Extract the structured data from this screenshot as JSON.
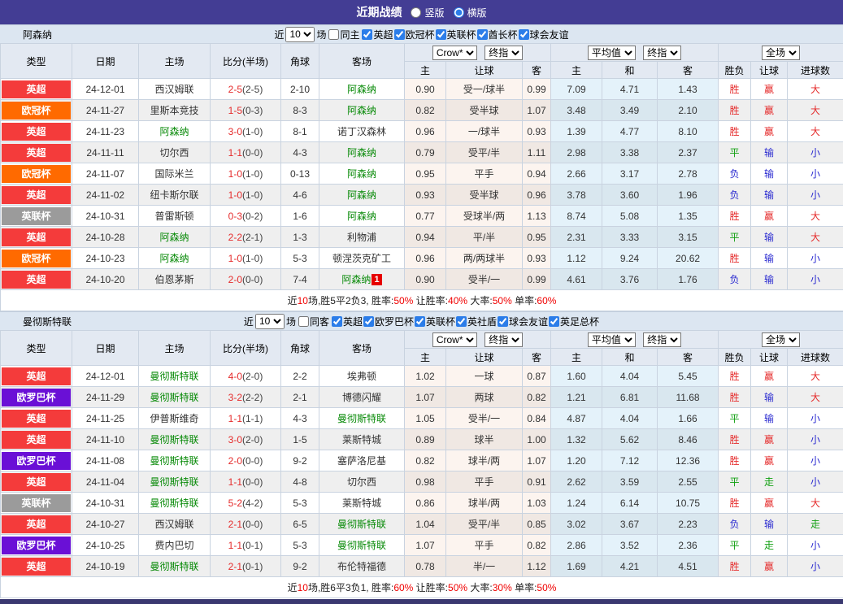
{
  "titlebar": {
    "title": "近期战绩",
    "vertical": "竖版",
    "horizontal": "横版"
  },
  "columns": {
    "type": "类型",
    "date": "日期",
    "home": "主场",
    "score": "比分(半场)",
    "corner": "角球",
    "away": "客场",
    "let_home": "主",
    "let_line": "让球",
    "let_away": "客",
    "avg_home": "主",
    "avg_draw": "和",
    "avg_away": "客",
    "result": "胜负",
    "handicap": "让球",
    "goals": "进球数"
  },
  "selects": {
    "company": "Crow*",
    "final": "终指",
    "average": "平均值",
    "scope": "全场"
  },
  "league_colors": {
    "英超": "#f43b3b",
    "欧冠杯": "#ff6a00",
    "英联杯": "#9b9b9b",
    "欧罗巴杯": "#6a10d6"
  },
  "mark_colors": {
    "胜": "#e52b2b",
    "平": "#12a012",
    "负": "#2a2ad0",
    "赢": "#e52b2b",
    "输": "#2a2ad0",
    "走": "#12a012",
    "大": "#e52b2b",
    "小": "#2a2ad0"
  },
  "sections": [
    {
      "team": "阿森纳",
      "filter": {
        "near_label": "近",
        "count": "10",
        "games_label": "场",
        "same_label": "同主",
        "same_checked": false,
        "leagues": [
          {
            "label": "英超",
            "checked": true
          },
          {
            "label": "欧冠杯",
            "checked": true
          },
          {
            "label": "英联杯",
            "checked": true
          },
          {
            "label": "酋长杯",
            "checked": true
          },
          {
            "label": "球会友谊",
            "checked": true
          }
        ]
      },
      "rows": [
        {
          "league": "英超",
          "date": "24-12-01",
          "home": "西汉姆联",
          "home_focus": false,
          "score": "2-5",
          "half": "(2-5)",
          "corner": "2-10",
          "away": "阿森纳",
          "away_focus": true,
          "let_home": "0.90",
          "let_line": "受一/球半",
          "let_away": "0.99",
          "avg_home": "7.09",
          "avg_draw": "4.71",
          "avg_away": "1.43",
          "result": "胜",
          "handicap": "赢",
          "goals": "大"
        },
        {
          "league": "欧冠杯",
          "date": "24-11-27",
          "home": "里斯本竞技",
          "home_focus": false,
          "score": "1-5",
          "half": "(0-3)",
          "corner": "8-3",
          "away": "阿森纳",
          "away_focus": true,
          "let_home": "0.82",
          "let_line": "受半球",
          "let_away": "1.07",
          "avg_home": "3.48",
          "avg_draw": "3.49",
          "avg_away": "2.10",
          "result": "胜",
          "handicap": "赢",
          "goals": "大"
        },
        {
          "league": "英超",
          "date": "24-11-23",
          "home": "阿森纳",
          "home_focus": true,
          "score": "3-0",
          "half": "(1-0)",
          "corner": "8-1",
          "away": "诺丁汉森林",
          "away_focus": false,
          "let_home": "0.96",
          "let_line": "一/球半",
          "let_away": "0.93",
          "avg_home": "1.39",
          "avg_draw": "4.77",
          "avg_away": "8.10",
          "result": "胜",
          "handicap": "赢",
          "goals": "大"
        },
        {
          "league": "英超",
          "date": "24-11-11",
          "home": "切尔西",
          "home_focus": false,
          "score": "1-1",
          "half": "(0-0)",
          "corner": "4-3",
          "away": "阿森纳",
          "away_focus": true,
          "let_home": "0.79",
          "let_line": "受平/半",
          "let_away": "1.11",
          "avg_home": "2.98",
          "avg_draw": "3.38",
          "avg_away": "2.37",
          "result": "平",
          "handicap": "输",
          "goals": "小"
        },
        {
          "league": "欧冠杯",
          "date": "24-11-07",
          "home": "国际米兰",
          "home_focus": false,
          "score": "1-0",
          "half": "(1-0)",
          "corner": "0-13",
          "away": "阿森纳",
          "away_focus": true,
          "let_home": "0.95",
          "let_line": "平手",
          "let_away": "0.94",
          "avg_home": "2.66",
          "avg_draw": "3.17",
          "avg_away": "2.78",
          "result": "负",
          "handicap": "输",
          "goals": "小"
        },
        {
          "league": "英超",
          "date": "24-11-02",
          "home": "纽卡斯尔联",
          "home_focus": false,
          "score": "1-0",
          "half": "(1-0)",
          "corner": "4-6",
          "away": "阿森纳",
          "away_focus": true,
          "let_home": "0.93",
          "let_line": "受半球",
          "let_away": "0.96",
          "avg_home": "3.78",
          "avg_draw": "3.60",
          "avg_away": "1.96",
          "result": "负",
          "handicap": "输",
          "goals": "小"
        },
        {
          "league": "英联杯",
          "date": "24-10-31",
          "home": "普雷斯顿",
          "home_focus": false,
          "score": "0-3",
          "half": "(0-2)",
          "corner": "1-6",
          "away": "阿森纳",
          "away_focus": true,
          "let_home": "0.77",
          "let_line": "受球半/两",
          "let_away": "1.13",
          "avg_home": "8.74",
          "avg_draw": "5.08",
          "avg_away": "1.35",
          "result": "胜",
          "handicap": "赢",
          "goals": "大"
        },
        {
          "league": "英超",
          "date": "24-10-28",
          "home": "阿森纳",
          "home_focus": true,
          "score": "2-2",
          "half": "(2-1)",
          "corner": "1-3",
          "away": "利物浦",
          "away_focus": false,
          "let_home": "0.94",
          "let_line": "平/半",
          "let_away": "0.95",
          "avg_home": "2.31",
          "avg_draw": "3.33",
          "avg_away": "3.15",
          "result": "平",
          "handicap": "输",
          "goals": "大"
        },
        {
          "league": "欧冠杯",
          "date": "24-10-23",
          "home": "阿森纳",
          "home_focus": true,
          "score": "1-0",
          "half": "(1-0)",
          "corner": "5-3",
          "away": "顿涅茨克矿工",
          "away_focus": false,
          "let_home": "0.96",
          "let_line": "两/两球半",
          "let_away": "0.93",
          "avg_home": "1.12",
          "avg_draw": "9.24",
          "avg_away": "20.62",
          "result": "胜",
          "handicap": "输",
          "goals": "小"
        },
        {
          "league": "英超",
          "date": "24-10-20",
          "home": "伯恩茅斯",
          "home_focus": false,
          "score": "2-0",
          "half": "(0-0)",
          "corner": "7-4",
          "away": "阿森纳",
          "away_focus": true,
          "away_badge": "1",
          "let_home": "0.90",
          "let_line": "受半/一",
          "let_away": "0.99",
          "avg_home": "4.61",
          "avg_draw": "3.76",
          "avg_away": "1.76",
          "result": "负",
          "handicap": "输",
          "goals": "小"
        }
      ],
      "summary": [
        {
          "t": "近",
          "c": "k"
        },
        {
          "t": "10",
          "c": "r"
        },
        {
          "t": "场,胜5平2负3, 胜率:",
          "c": "k"
        },
        {
          "t": "50%",
          "c": "r"
        },
        {
          "t": " 让胜率:",
          "c": "k"
        },
        {
          "t": "40%",
          "c": "r"
        },
        {
          "t": " 大率:",
          "c": "k"
        },
        {
          "t": "50%",
          "c": "r"
        },
        {
          "t": " 单率:",
          "c": "k"
        },
        {
          "t": "60%",
          "c": "r"
        }
      ]
    },
    {
      "team": "曼彻斯特联",
      "filter": {
        "near_label": "近",
        "count": "10",
        "games_label": "场",
        "same_label": "同客",
        "same_checked": false,
        "leagues": [
          {
            "label": "英超",
            "checked": true
          },
          {
            "label": "欧罗巴杯",
            "checked": true
          },
          {
            "label": "英联杯",
            "checked": true
          },
          {
            "label": "英社盾",
            "checked": true
          },
          {
            "label": "球会友谊",
            "checked": true
          },
          {
            "label": "英足总杯",
            "checked": true
          }
        ]
      },
      "rows": [
        {
          "league": "英超",
          "date": "24-12-01",
          "home": "曼彻斯特联",
          "home_focus": true,
          "score": "4-0",
          "half": "(2-0)",
          "corner": "2-2",
          "away": "埃弗顿",
          "away_focus": false,
          "let_home": "1.02",
          "let_line": "一球",
          "let_away": "0.87",
          "avg_home": "1.60",
          "avg_draw": "4.04",
          "avg_away": "5.45",
          "result": "胜",
          "handicap": "赢",
          "goals": "大"
        },
        {
          "league": "欧罗巴杯",
          "date": "24-11-29",
          "home": "曼彻斯特联",
          "home_focus": true,
          "score": "3-2",
          "half": "(2-2)",
          "corner": "2-1",
          "away": "博德闪耀",
          "away_focus": false,
          "let_home": "1.07",
          "let_line": "两球",
          "let_away": "0.82",
          "avg_home": "1.21",
          "avg_draw": "6.81",
          "avg_away": "11.68",
          "result": "胜",
          "handicap": "输",
          "goals": "大"
        },
        {
          "league": "英超",
          "date": "24-11-25",
          "home": "伊普斯维奇",
          "home_focus": false,
          "score": "1-1",
          "half": "(1-1)",
          "corner": "4-3",
          "away": "曼彻斯特联",
          "away_focus": true,
          "let_home": "1.05",
          "let_line": "受半/一",
          "let_away": "0.84",
          "avg_home": "4.87",
          "avg_draw": "4.04",
          "avg_away": "1.66",
          "result": "平",
          "handicap": "输",
          "goals": "小"
        },
        {
          "league": "英超",
          "date": "24-11-10",
          "home": "曼彻斯特联",
          "home_focus": true,
          "score": "3-0",
          "half": "(2-0)",
          "corner": "1-5",
          "away": "莱斯特城",
          "away_focus": false,
          "let_home": "0.89",
          "let_line": "球半",
          "let_away": "1.00",
          "avg_home": "1.32",
          "avg_draw": "5.62",
          "avg_away": "8.46",
          "result": "胜",
          "handicap": "赢",
          "goals": "小"
        },
        {
          "league": "欧罗巴杯",
          "date": "24-11-08",
          "home": "曼彻斯特联",
          "home_focus": true,
          "score": "2-0",
          "half": "(0-0)",
          "corner": "9-2",
          "away": "塞萨洛尼基",
          "away_focus": false,
          "let_home": "0.82",
          "let_line": "球半/两",
          "let_away": "1.07",
          "avg_home": "1.20",
          "avg_draw": "7.12",
          "avg_away": "12.36",
          "result": "胜",
          "handicap": "赢",
          "goals": "小"
        },
        {
          "league": "英超",
          "date": "24-11-04",
          "home": "曼彻斯特联",
          "home_focus": true,
          "score": "1-1",
          "half": "(0-0)",
          "corner": "4-8",
          "away": "切尔西",
          "away_focus": false,
          "let_home": "0.98",
          "let_line": "平手",
          "let_away": "0.91",
          "avg_home": "2.62",
          "avg_draw": "3.59",
          "avg_away": "2.55",
          "result": "平",
          "handicap": "走",
          "goals": "小"
        },
        {
          "league": "英联杯",
          "date": "24-10-31",
          "home": "曼彻斯特联",
          "home_focus": true,
          "score": "5-2",
          "half": "(4-2)",
          "corner": "5-3",
          "away": "莱斯特城",
          "away_focus": false,
          "let_home": "0.86",
          "let_line": "球半/两",
          "let_away": "1.03",
          "avg_home": "1.24",
          "avg_draw": "6.14",
          "avg_away": "10.75",
          "result": "胜",
          "handicap": "赢",
          "goals": "大"
        },
        {
          "league": "英超",
          "date": "24-10-27",
          "home": "西汉姆联",
          "home_focus": false,
          "score": "2-1",
          "half": "(0-0)",
          "corner": "6-5",
          "away": "曼彻斯特联",
          "away_focus": true,
          "let_home": "1.04",
          "let_line": "受平/半",
          "let_away": "0.85",
          "avg_home": "3.02",
          "avg_draw": "3.67",
          "avg_away": "2.23",
          "result": "负",
          "handicap": "输",
          "goals": "走"
        },
        {
          "league": "欧罗巴杯",
          "date": "24-10-25",
          "home": "费内巴切",
          "home_focus": false,
          "score": "1-1",
          "half": "(0-1)",
          "corner": "5-3",
          "away": "曼彻斯特联",
          "away_focus": true,
          "let_home": "1.07",
          "let_line": "平手",
          "let_away": "0.82",
          "avg_home": "2.86",
          "avg_draw": "3.52",
          "avg_away": "2.36",
          "result": "平",
          "handicap": "走",
          "goals": "小"
        },
        {
          "league": "英超",
          "date": "24-10-19",
          "home": "曼彻斯特联",
          "home_focus": true,
          "score": "2-1",
          "half": "(0-1)",
          "corner": "9-2",
          "away": "布伦特福德",
          "away_focus": false,
          "let_home": "0.78",
          "let_line": "半/一",
          "let_away": "1.12",
          "avg_home": "1.69",
          "avg_draw": "4.21",
          "avg_away": "4.51",
          "result": "胜",
          "handicap": "赢",
          "goals": "小"
        }
      ],
      "summary": [
        {
          "t": "近",
          "c": "k"
        },
        {
          "t": "10",
          "c": "r"
        },
        {
          "t": "场,胜6平3负1, 胜率:",
          "c": "k"
        },
        {
          "t": "60%",
          "c": "r"
        },
        {
          "t": " 让胜率:",
          "c": "k"
        },
        {
          "t": "50%",
          "c": "r"
        },
        {
          "t": " 大率:",
          "c": "k"
        },
        {
          "t": "30%",
          "c": "r"
        },
        {
          "t": " 单率:",
          "c": "k"
        },
        {
          "t": "50%",
          "c": "r"
        }
      ]
    }
  ]
}
